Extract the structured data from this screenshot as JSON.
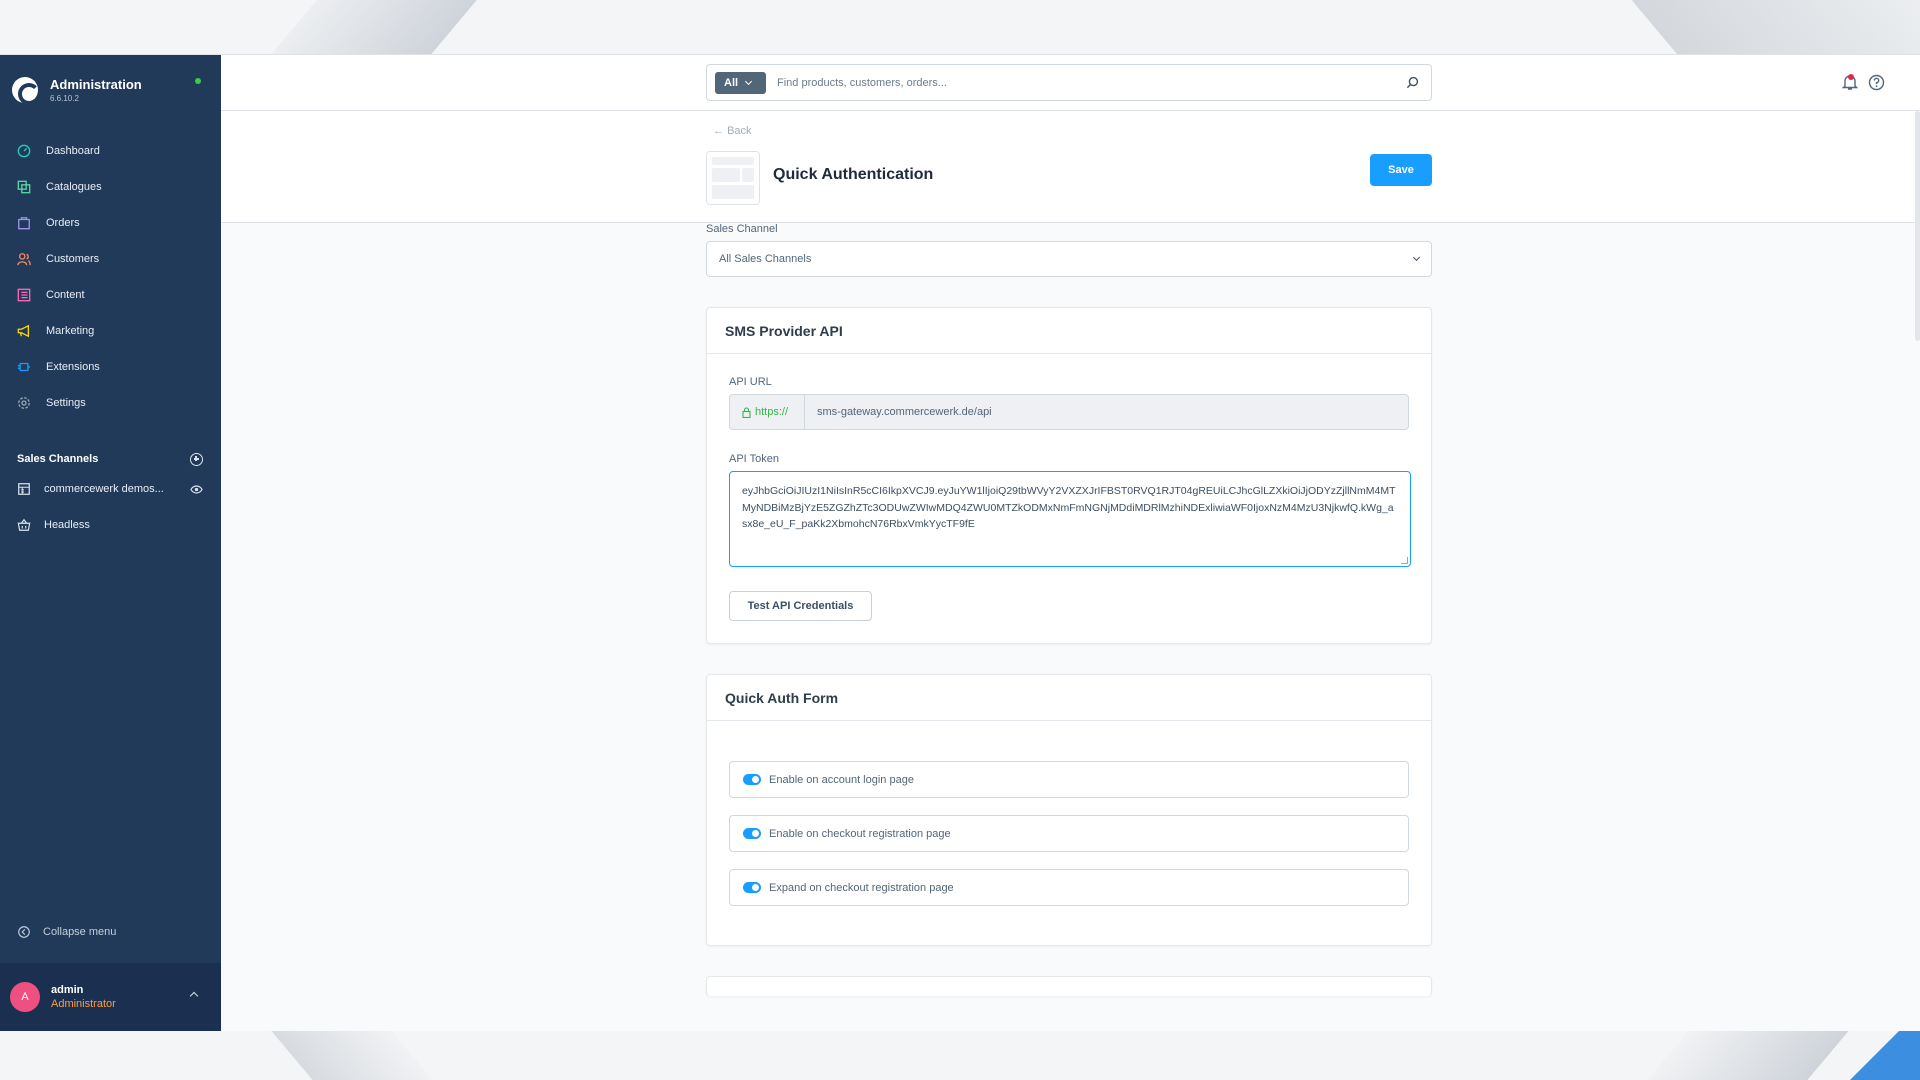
{
  "app": {
    "title": "Administration",
    "version": "6.6.10.2"
  },
  "sidebar": {
    "items": [
      {
        "label": "Dashboard",
        "icon": "dashboard-icon",
        "color": "#27cbbc"
      },
      {
        "label": "Catalogues",
        "icon": "catalogues-icon",
        "color": "#57d9a3"
      },
      {
        "label": "Orders",
        "icon": "orders-icon",
        "color": "#a092f0"
      },
      {
        "label": "Customers",
        "icon": "customers-icon",
        "color": "#f88962"
      },
      {
        "label": "Content",
        "icon": "content-icon",
        "color": "#ff68b4"
      },
      {
        "label": "Marketing",
        "icon": "marketing-icon",
        "color": "#ffd700"
      },
      {
        "label": "Extensions",
        "icon": "extensions-icon",
        "color": "#189eff"
      },
      {
        "label": "Settings",
        "icon": "settings-icon",
        "color": "#9aa8b5"
      }
    ],
    "sales_channels_title": "Sales Channels",
    "channels": [
      {
        "label": "commercewerk demos...",
        "icon": "storefront-icon"
      },
      {
        "label": "Headless",
        "icon": "basket-icon"
      }
    ],
    "collapse_label": "Collapse menu",
    "user": {
      "initial": "A",
      "name": "admin",
      "role": "Administrator"
    }
  },
  "search": {
    "type_label": "All",
    "placeholder": "Find products, customers, orders..."
  },
  "header": {
    "back_label": "Back",
    "title": "Quick Authentication",
    "save_label": "Save"
  },
  "sales_channel": {
    "label": "Sales Channel",
    "value": "All Sales Channels"
  },
  "sms_card": {
    "title": "SMS Provider API",
    "api_url_label": "API URL",
    "api_url_prefix": "https://",
    "api_url_value": "sms-gateway.commercewerk.de/api",
    "api_token_label": "API Token",
    "api_token_value": "eyJhbGciOiJIUzI1NiIsInR5cCI6IkpXVCJ9.eyJuYW1lIjoiQ29tbWVyY2VXZXJrIFBST0RVQ1RJT04gREUiLCJhcGlLZXkiOiJjODYzZjllNmM4MTMyNDBiMzBjYzE5ZGZhZTc3ODUwZWIwMDQ4ZWU0MTZkODMxNmFmNGNjMDdiMDRlMzhiNDExliwiaWF0IjoxNzM4MzU3NjkwfQ.kWg_asx8e_eU_F_paKk2XbmohcN76RbxVmkYycTF9fE",
    "test_button_label": "Test API Credentials"
  },
  "quick_auth_card": {
    "title": "Quick Auth Form",
    "toggles": [
      {
        "label": "Enable on account login page",
        "checked": true
      },
      {
        "label": "Enable on checkout registration page",
        "checked": true
      },
      {
        "label": "Expand on checkout registration page",
        "checked": true
      }
    ]
  },
  "colors": {
    "sidebar": "#223a5a",
    "primary": "#189eff",
    "success": "#37b74a"
  }
}
